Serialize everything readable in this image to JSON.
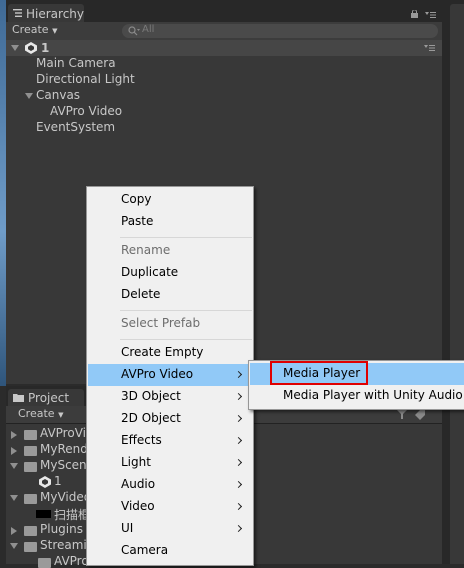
{
  "hierarchy": {
    "tab_label": "Hierarchy",
    "create_label": "Create",
    "search_placeholder": "All",
    "scene_name": "1",
    "items": [
      "Main Camera",
      "Directional Light",
      "Canvas",
      "AVPro Video",
      "EventSystem"
    ]
  },
  "project": {
    "tab_label": "Project",
    "create_label": "Create",
    "items": [
      "AVProVi",
      "MyRend",
      "MyScen",
      "1",
      "MyVideo",
      "扫描框",
      "Plugins",
      "Streamin",
      "AVPro"
    ]
  },
  "context_menu": {
    "items": [
      {
        "label": "Copy",
        "disabled": false
      },
      {
        "label": "Paste",
        "disabled": false
      },
      {
        "label": "Rename",
        "disabled": true
      },
      {
        "label": "Duplicate",
        "disabled": false
      },
      {
        "label": "Delete",
        "disabled": false
      },
      {
        "label": "Select Prefab",
        "disabled": true
      },
      {
        "label": "Create Empty",
        "disabled": false
      },
      {
        "label": "AVPro Video",
        "disabled": false,
        "highlighted": true
      },
      {
        "label": "3D Object",
        "disabled": false
      },
      {
        "label": "2D Object",
        "disabled": false
      },
      {
        "label": "Effects",
        "disabled": false
      },
      {
        "label": "Light",
        "disabled": false
      },
      {
        "label": "Audio",
        "disabled": false
      },
      {
        "label": "Video",
        "disabled": false
      },
      {
        "label": "UI",
        "disabled": false
      },
      {
        "label": "Camera",
        "disabled": false
      }
    ]
  },
  "submenu": {
    "items": [
      {
        "label": "Media Player",
        "highlighted": true
      },
      {
        "label": "Media Player with Unity Audio",
        "highlighted": false
      }
    ]
  },
  "colors": {
    "menu_bg": "#f0f0f0",
    "menu_highlight": "#91c9f7",
    "outline_red": "#e00000",
    "panel_bg": "#383838"
  }
}
